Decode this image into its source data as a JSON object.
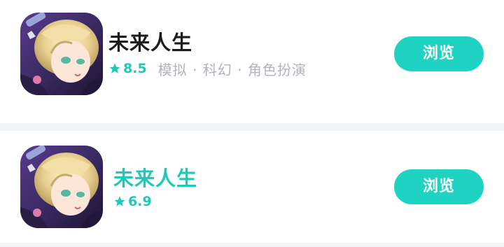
{
  "items": [
    {
      "title": "未来人生",
      "rating": "8.5",
      "tags": "模拟 · 科幻 · 角色扮演",
      "button_label": "浏览",
      "icon": "anime-character-app-icon"
    },
    {
      "title": "未来人生",
      "rating": "6.9",
      "button_label": "浏览",
      "icon": "anime-character-app-icon"
    }
  ],
  "colors": {
    "accent": "#1fd3c2",
    "accent_text": "#1fc9b8",
    "title_dark": "#1c1c1c",
    "tag_gray": "#b0b3ba",
    "background": "#f4f5f7"
  }
}
